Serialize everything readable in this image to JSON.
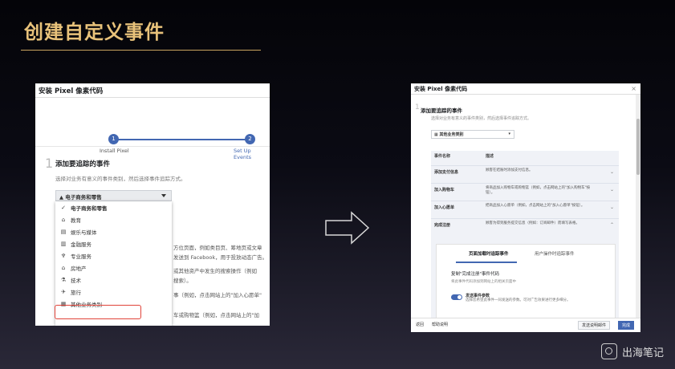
{
  "slide": {
    "title": "创建自定义事件",
    "brand": "出海笔记"
  },
  "left": {
    "header": "安装 Pixel 像素代码",
    "steps": [
      {
        "num": "1",
        "label": "Install Pixel"
      },
      {
        "num": "2",
        "label": "Set Up Events"
      }
    ],
    "section_num": "1",
    "heading": "添加要追踪的事件",
    "subtitle": "选择对业务有意义的事件类别，然后选择事件追踪方式。",
    "dropdown_value": "电子商务和零售",
    "options": [
      {
        "label": "电子商务和零售",
        "icon": "✓",
        "selected": true
      },
      {
        "label": "教育",
        "icon": "⌂"
      },
      {
        "label": "娱乐与媒体",
        "icon": "▤"
      },
      {
        "label": "金融服务",
        "icon": "▥"
      },
      {
        "label": "专业服务",
        "icon": "♆"
      },
      {
        "label": "房地产",
        "icon": "⌂"
      },
      {
        "label": "技术",
        "icon": "⚗"
      },
      {
        "label": "旅行",
        "icon": "✈"
      },
      {
        "label": "其他业务类别",
        "icon": "▦"
      }
    ],
    "bg_lines": [
      "方位页面，例如类目页、筹地页或文章",
      "发送到 Facebook，用于投放动态广告。",
      "或其他资产中发生的搜索操作（例如",
      "搜索）。",
      "事（例如，点击网站上的\"加入心愿单\"",
      "车或购物篮（例如，点击网站上的\"加"
    ]
  },
  "right": {
    "header": "安装 Pixel 像素代码",
    "section_num": "1",
    "heading": "添加要追踪的事件",
    "subtitle": "选择对业务有意义的事件类别，然后选择事件追踪方式。",
    "dropdown_value": "其他业务类别",
    "col_name": "事件名称",
    "col_desc": "描述",
    "rows": [
      {
        "name": "添加支付信息",
        "desc": "顾客在结账时添加支付信息。"
      },
      {
        "name": "加入购物车",
        "desc": "将商品加入购物车或购物篮（例如，点击网站上的\"加入购物车\"按钮）。"
      },
      {
        "name": "加入心愿单",
        "desc": "把商品加入心愿单（例如，点击网站上的\"加入心愿单\"按钮）。"
      },
      {
        "name": "完成注册",
        "desc": "顾客为得到服务提交信息（例如：订阅邮件）而填写表格。"
      }
    ],
    "tabs": [
      "页面加载时追踪事件",
      "用户操作时追踪事件"
    ],
    "card_heading": "复制\"完成注册\"事件代码",
    "card_sub": "将此事件代码添加到网站上的相关页面中",
    "toggle_label": "发送事件参数",
    "toggle_desc": "选择您希望此事件一同发送的参数。可对广告效果进行更多细分。",
    "footer": {
      "back": "返回",
      "help": "帮助说明",
      "secondary": "发送说明邮件",
      "primary": "完成"
    }
  }
}
